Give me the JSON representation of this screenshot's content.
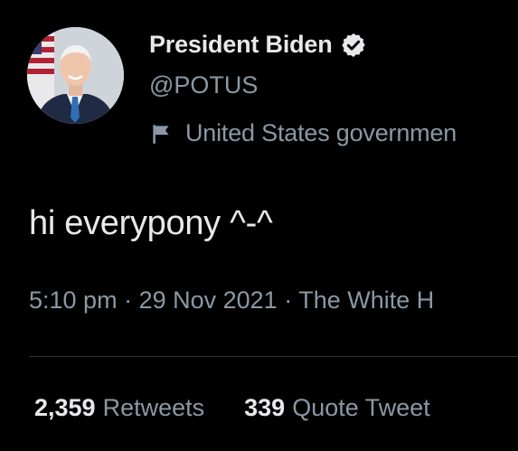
{
  "tweet": {
    "author": {
      "display_name": "President Biden",
      "handle": "@POTUS",
      "verified": true,
      "verified_icon": "verified-badge-icon",
      "affiliation_icon": "flag-icon",
      "affiliation_label": "United States governmen"
    },
    "text": "hi everypony ^-^",
    "meta": {
      "time": "5:10 pm",
      "separator": " · ",
      "date": "29 Nov 2021",
      "source": "The White H"
    },
    "stats": [
      {
        "count": "2,359",
        "label": "Retweets"
      },
      {
        "count": "339",
        "label": "Quote Tweet"
      }
    ]
  },
  "colors": {
    "background": "#000000",
    "primary_text": "#e7e9ea",
    "secondary_text": "#8b98a5",
    "divider": "#2f3336"
  }
}
